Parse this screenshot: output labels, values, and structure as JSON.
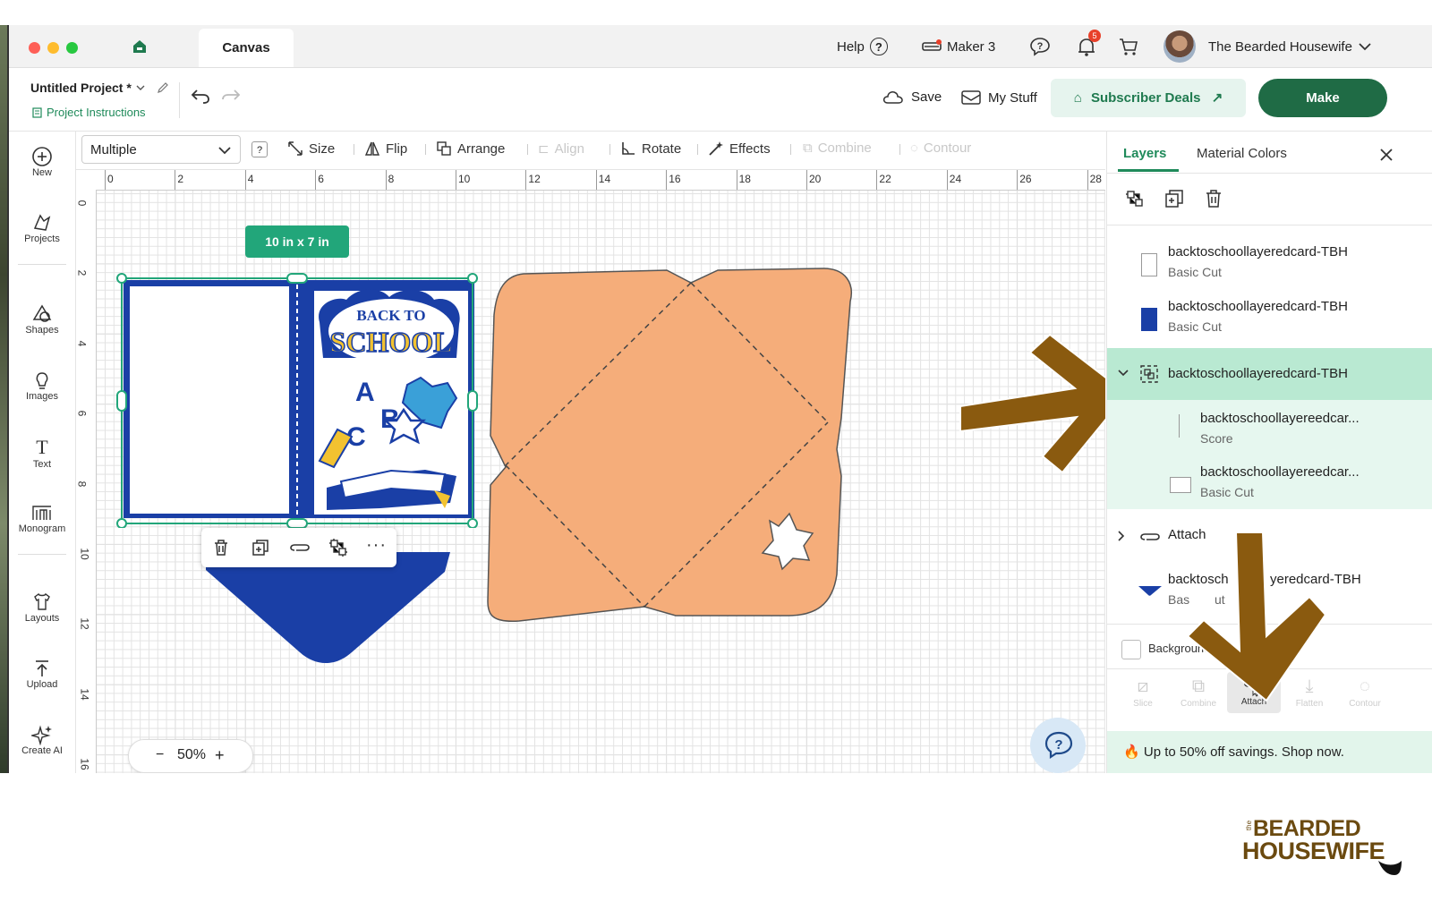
{
  "window": {
    "tab_title": "Canvas"
  },
  "topbar": {
    "help_label": "Help",
    "machine_label": "Maker 3",
    "notification_count": "5",
    "user_name": "The Bearded Housewife"
  },
  "project": {
    "title": "Untitled Project *",
    "instructions_label": "Project Instructions",
    "save_label": "Save",
    "mystuff_label": "My Stuff",
    "deals_label": "Subscriber Deals",
    "make_label": "Make"
  },
  "sidebar": {
    "items": [
      {
        "label": "New",
        "icon": "plus-circle-icon"
      },
      {
        "label": "Projects",
        "icon": "projects-icon"
      },
      {
        "label": "Shapes",
        "icon": "shapes-icon"
      },
      {
        "label": "Images",
        "icon": "lightbulb-icon"
      },
      {
        "label": "Text",
        "icon": "text-icon"
      },
      {
        "label": "Monogram",
        "icon": "monogram-icon"
      },
      {
        "label": "Layouts",
        "icon": "layouts-icon"
      },
      {
        "label": "Upload",
        "icon": "upload-icon"
      },
      {
        "label": "Create AI",
        "icon": "sparkle-icon"
      }
    ]
  },
  "toolbar": {
    "select_value": "Multiple",
    "help_mark": "?",
    "size_label": "Size",
    "flip_label": "Flip",
    "arrange_label": "Arrange",
    "align_label": "Align",
    "rotate_label": "Rotate",
    "effects_label": "Effects",
    "combine_label": "Combine",
    "contour_label": "Contour"
  },
  "canvas": {
    "size_badge": "10 in x 7 in",
    "zoom_label": "50%",
    "zoom_minus": "−",
    "zoom_plus": "+",
    "ruler_top": [
      "0",
      "2",
      "4",
      "6",
      "8",
      "10",
      "12",
      "14",
      "16",
      "18",
      "20",
      "22",
      "24",
      "26",
      "28"
    ],
    "ruler_left": [
      "0",
      "2",
      "4",
      "6",
      "8",
      "10",
      "12",
      "14",
      "16"
    ],
    "card_text_line1": "BACK TO",
    "card_text_line2": "SCHOOL",
    "letters": [
      "A",
      "B",
      "C"
    ],
    "colors": {
      "envelope": "#f5ad7a",
      "card_blue": "#1a3fa6",
      "accent_green": "#1f6b45",
      "arrow_brown": "#8a5a0f",
      "selection_teal": "#22a67a"
    }
  },
  "panel": {
    "tab_layers": "Layers",
    "tab_material": "Material Colors",
    "layers": [
      {
        "name": "backtoschoollayeredcard-TBH",
        "sub": "Basic Cut",
        "swatch": "#ffffff"
      },
      {
        "name": "backtoschoollayeredcard-TBH",
        "sub": "Basic Cut",
        "swatch": "#1a3fa6"
      },
      {
        "name": "backtoschoollayeredcard-TBH",
        "sub": "",
        "swatch": "group"
      },
      {
        "name": "backtoschoollayereedcar...",
        "sub": "Score",
        "swatch": "score"
      },
      {
        "name": "backtoschoollayereedcar...",
        "sub": "Basic Cut",
        "swatch": "#ffffff"
      },
      {
        "name": "Attach",
        "sub": "",
        "swatch": "attach"
      },
      {
        "name": "backtosch",
        "name_end": "yeredcard-TBH",
        "sub": "Bas",
        "sub_end": "ut",
        "swatch": "#1a3fa6"
      }
    ],
    "background_label": "Background C",
    "bottom_tools": [
      "Slice",
      "Combine",
      "Attach",
      "Flatten",
      "Contour"
    ],
    "promo": "Up to 50% off savings. Shop now."
  },
  "logo": {
    "line1": "BEARDED",
    "line2": "HOUSEWIFE",
    "small": "the"
  }
}
